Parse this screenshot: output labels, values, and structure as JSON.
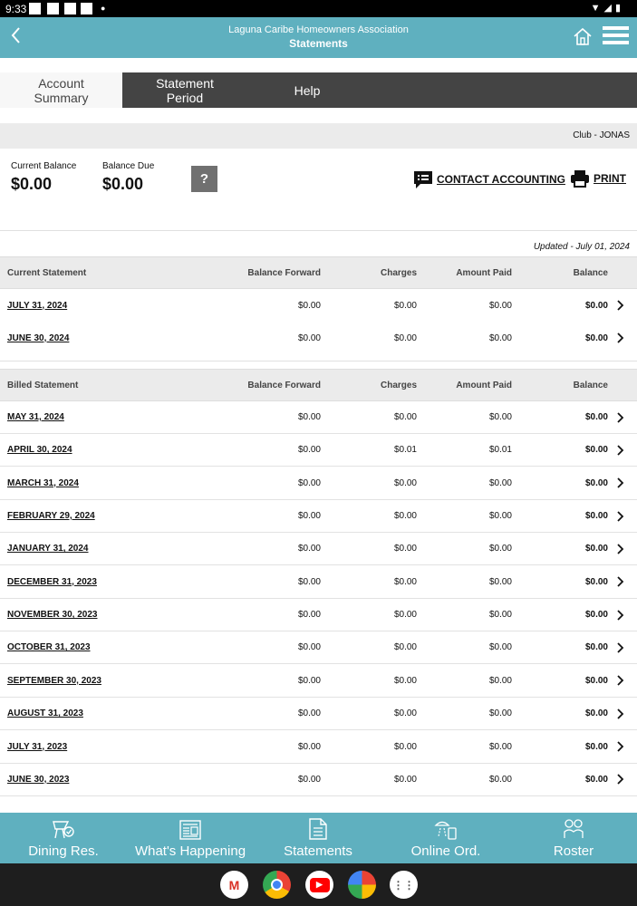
{
  "status_bar": {
    "time": "9:33"
  },
  "header": {
    "subtitle": "Laguna Caribe Homeowners Association",
    "title": "Statements"
  },
  "tabs": [
    {
      "label": "Account\nSummary",
      "active": true
    },
    {
      "label": "Statement\nPeriod",
      "active": false
    },
    {
      "label": "Help",
      "active": false
    }
  ],
  "club": "Club - JONAS",
  "balances": {
    "current_label": "Current Balance",
    "current_value": "$0.00",
    "due_label": "Balance Due",
    "due_value": "$0.00",
    "help_button": "?"
  },
  "actions": {
    "contact": "CONTACT ACCOUNTING",
    "print": "PRINT"
  },
  "updated": "Updated - July 01, 2024",
  "current_table": {
    "headers": [
      "Current Statement",
      "Balance Forward",
      "Charges",
      "Amount Paid",
      "Balance"
    ],
    "rows": [
      [
        "JULY 31, 2024",
        "$0.00",
        "$0.00",
        "$0.00",
        "$0.00"
      ],
      [
        "JUNE 30, 2024",
        "$0.00",
        "$0.00",
        "$0.00",
        "$0.00"
      ]
    ]
  },
  "billed_table": {
    "headers": [
      "Billed Statement",
      "Balance Forward",
      "Charges",
      "Amount Paid",
      "Balance"
    ],
    "rows": [
      [
        "MAY 31, 2024",
        "$0.00",
        "$0.00",
        "$0.00",
        "$0.00"
      ],
      [
        "APRIL 30, 2024",
        "$0.00",
        "$0.01",
        "$0.01",
        "$0.00"
      ],
      [
        "MARCH 31, 2024",
        "$0.00",
        "$0.00",
        "$0.00",
        "$0.00"
      ],
      [
        "FEBRUARY 29, 2024",
        "$0.00",
        "$0.00",
        "$0.00",
        "$0.00"
      ],
      [
        "JANUARY 31, 2024",
        "$0.00",
        "$0.00",
        "$0.00",
        "$0.00"
      ],
      [
        "DECEMBER 31, 2023",
        "$0.00",
        "$0.00",
        "$0.00",
        "$0.00"
      ],
      [
        "NOVEMBER 30, 2023",
        "$0.00",
        "$0.00",
        "$0.00",
        "$0.00"
      ],
      [
        "OCTOBER 31, 2023",
        "$0.00",
        "$0.00",
        "$0.00",
        "$0.00"
      ],
      [
        "SEPTEMBER 30, 2023",
        "$0.00",
        "$0.00",
        "$0.00",
        "$0.00"
      ],
      [
        "AUGUST 31, 2023",
        "$0.00",
        "$0.00",
        "$0.00",
        "$0.00"
      ],
      [
        "JULY 31, 2023",
        "$0.00",
        "$0.00",
        "$0.00",
        "$0.00"
      ],
      [
        "JUNE 30, 2023",
        "$0.00",
        "$0.00",
        "$0.00",
        "$0.00"
      ]
    ]
  },
  "bottom_nav": [
    {
      "label": "Dining Res.",
      "icon": "dining-icon"
    },
    {
      "label": "What's Happening",
      "icon": "newspaper-icon"
    },
    {
      "label": "Statements",
      "icon": "document-icon"
    },
    {
      "label": "Online Ord.",
      "icon": "online-order-icon"
    },
    {
      "label": "Roster",
      "icon": "people-icon"
    }
  ],
  "system_apps": [
    "gmail-icon",
    "chrome-icon",
    "youtube-icon",
    "photos-icon",
    "app-drawer-icon"
  ],
  "colors": {
    "accent": "#5fb0bf",
    "tab_bar": "#444444"
  }
}
